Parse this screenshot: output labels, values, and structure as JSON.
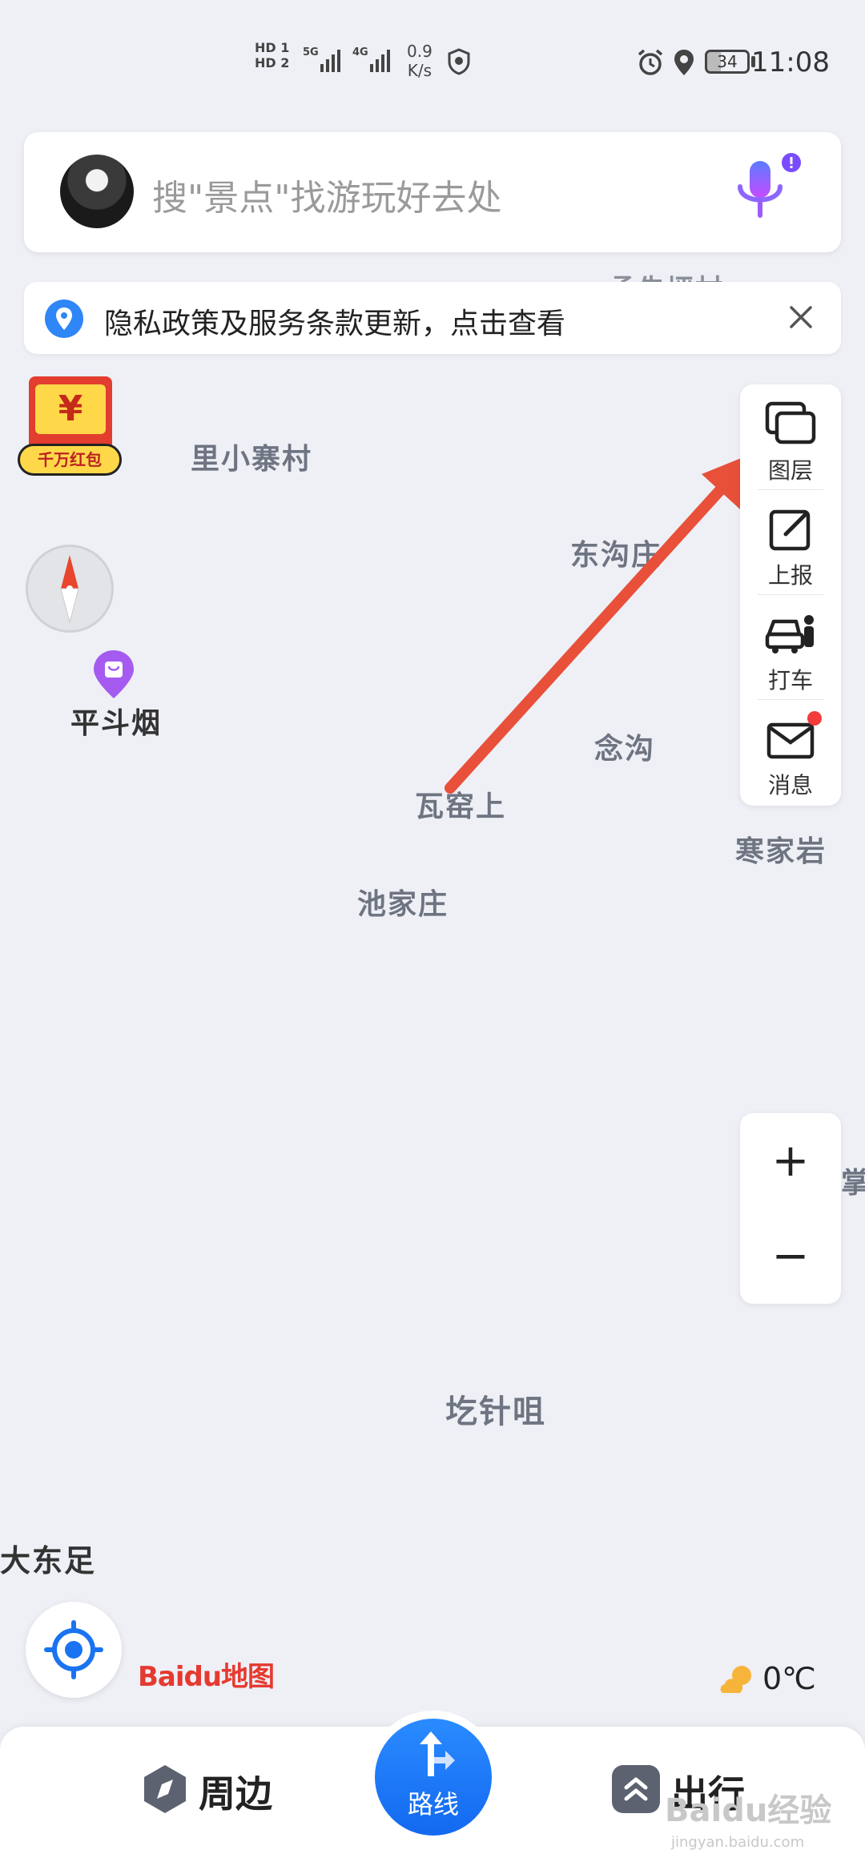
{
  "status_bar": {
    "network1": "HD",
    "sim1": "1",
    "network2": "HD",
    "sim2": "2",
    "signal1": "5G",
    "signal2": "4G",
    "speed_value": "0.9",
    "speed_unit": "K/s",
    "battery": "34",
    "time": "11:08"
  },
  "search": {
    "placeholder": "搜\"景点\"找游玩好去处"
  },
  "notice": {
    "text": "隐私政策及服务条款更新，点击查看"
  },
  "red_envelope": {
    "symbol": "¥",
    "label": "千万红包"
  },
  "map_labels": {
    "l1": "里小寨村",
    "l2": "东沟庄",
    "l3": "念沟",
    "l4": "瓦窑上",
    "l5": "寒家岩",
    "l6": "池家庄",
    "l7": "圪针咀",
    "l8": "大东足",
    "l9": "掌",
    "l10": "平斗烟",
    "l11": "孟先坪村"
  },
  "toolbar": {
    "layers": "图层",
    "report": "上报",
    "taxi": "打车",
    "messages": "消息"
  },
  "zoom": {
    "plus": "+",
    "minus": "−"
  },
  "weather": {
    "temp": "0℃"
  },
  "logo": {
    "text": "Baidu地图"
  },
  "bottom_nav": {
    "nearby": "周边",
    "route": "路线",
    "travel": "出行"
  },
  "watermark": {
    "text": "Baidu经验",
    "sub": "jingyan.baidu.com"
  },
  "colors": {
    "accent": "#1a73f0",
    "arrow": "#e8503a",
    "badge": "#f23b3b",
    "map_bg": "#eef0f6"
  }
}
